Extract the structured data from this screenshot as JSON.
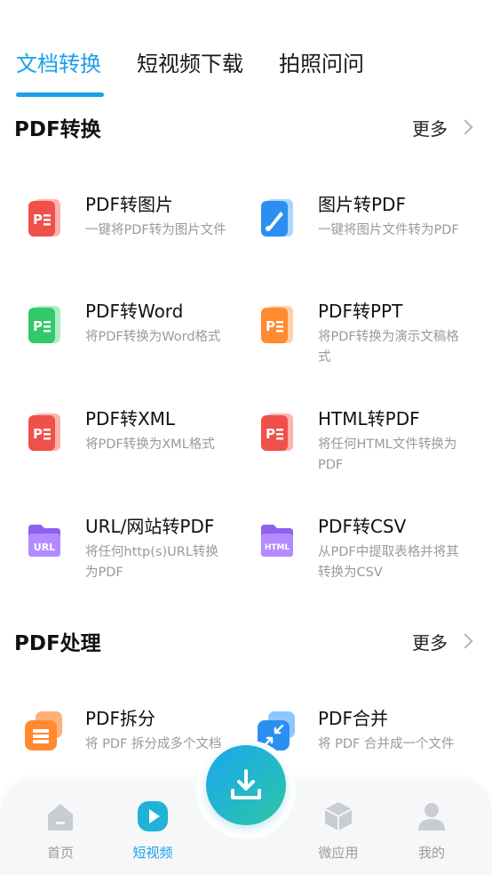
{
  "tabs": [
    {
      "label": "文档转换",
      "active": true
    },
    {
      "label": "短视频下载",
      "active": false
    },
    {
      "label": "拍照问问",
      "active": false
    }
  ],
  "sections": {
    "convert": {
      "title": "PDF转换",
      "more": "更多"
    },
    "process": {
      "title": "PDF处理",
      "more": "更多"
    }
  },
  "tools": [
    {
      "title": "PDF转图片",
      "desc": "一键将PDF转为图片文件",
      "icon": "pdf-red-icon"
    },
    {
      "title": "图片转PDF",
      "desc": "一键将图片文件转为PDF",
      "icon": "image-blue-icon"
    },
    {
      "title": "PDF转Word",
      "desc": "将PDF转换为Word格式",
      "icon": "pdf-green-icon"
    },
    {
      "title": "PDF转PPT",
      "desc": "将PDF转换为演示文稿格式",
      "icon": "pdf-orange-icon"
    },
    {
      "title": "PDF转XML",
      "desc": "将PDF转换为XML格式",
      "icon": "pdf-red-icon"
    },
    {
      "title": "HTML转PDF",
      "desc": "将任何HTML文件转换为PDF",
      "icon": "pdf-red-icon"
    },
    {
      "title": "URL/网站转PDF",
      "desc": "将任何http(s)URL转换为PDF",
      "icon": "url-folder-icon",
      "badge": "URL"
    },
    {
      "title": "PDF转CSV",
      "desc": "从PDF中提取表格并将其转换为CSV",
      "icon": "html-folder-icon",
      "badge": "HTML"
    },
    {
      "title": "PDF拆分",
      "desc": "将 PDF 拆分成多个文档",
      "icon": "split-orange-icon"
    },
    {
      "title": "PDF合并",
      "desc": "将 PDF 合并成一个文件",
      "icon": "merge-blue-icon"
    }
  ],
  "nav": [
    {
      "label": "首页",
      "icon": "home-icon",
      "active": false
    },
    {
      "label": "短视频",
      "icon": "video-play-icon",
      "active": true
    },
    {
      "label": "微应用",
      "icon": "cube-icon",
      "active": false
    },
    {
      "label": "我的",
      "icon": "user-icon",
      "active": false
    }
  ],
  "fab": {
    "icon": "download-icon"
  },
  "colors": {
    "accent": "#1aa0e8",
    "red": "#f0504a",
    "green": "#33c86a",
    "orange": "#ff8a30",
    "blue": "#2a8ff0",
    "purple": "#9060f0"
  }
}
